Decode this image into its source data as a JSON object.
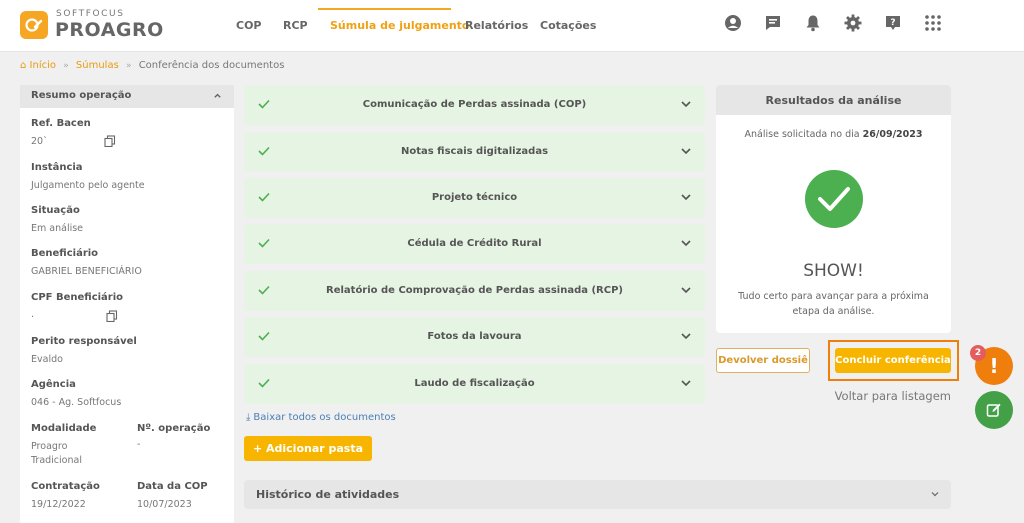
{
  "brand": {
    "small": "SOFTFOCUS",
    "big": "PROAGRO"
  },
  "nav": [
    {
      "label": "COP"
    },
    {
      "label": "RCP"
    },
    {
      "label": "Súmula de julgamento",
      "active": true
    },
    {
      "label": "Relatórios"
    },
    {
      "label": "Cotações"
    }
  ],
  "header_icons": [
    "user-icon",
    "chat-icon",
    "bell-icon",
    "gear-icon",
    "help-icon",
    "apps-grid-icon"
  ],
  "breadcrumb": {
    "home": "Início",
    "level2": "Súmulas",
    "current": "Conferência dos documentos",
    "home_icon": "home-icon"
  },
  "summary": {
    "title": "Resumo operação",
    "fields": {
      "ref_bacen": {
        "label": "Ref. Bacen",
        "value": "20`"
      },
      "instancia": {
        "label": "Instância",
        "value": "Julgamento pelo agente"
      },
      "situacao": {
        "label": "Situação",
        "value": "Em análise"
      },
      "beneficiario": {
        "label": "Beneficiário",
        "value": "GABRIEL BENEFICIÁRIO"
      },
      "cpf": {
        "label": "CPF Beneficiário",
        "value": "."
      },
      "perito": {
        "label": "Perito responsável",
        "value": "Evaldo"
      },
      "agencia": {
        "label": "Agência",
        "value": "046 - Ag. Softfocus"
      },
      "modalidade": {
        "label": "Modalidade",
        "value_line1": "Proagro",
        "value_line2": "Tradicional"
      },
      "n_operacao": {
        "label": "Nº. operação",
        "value": "-"
      },
      "contratacao": {
        "label": "Contratação",
        "value": "19/12/2022"
      },
      "data_cop": {
        "label": "Data da COP",
        "value": "10/07/2023"
      }
    }
  },
  "documents": [
    {
      "title": "Comunicação de Perdas assinada (COP)",
      "status": "ok"
    },
    {
      "title": "Notas fiscais digitalizadas",
      "status": "ok"
    },
    {
      "title": "Projeto técnico",
      "status": "ok"
    },
    {
      "title": "Cédula de Crédito Rural",
      "status": "ok"
    },
    {
      "title": "Relatório de Comprovação de Perdas assinada (RCP)",
      "status": "ok"
    },
    {
      "title": "Fotos da lavoura",
      "status": "ok"
    },
    {
      "title": "Laudo de fiscalização",
      "status": "ok"
    }
  ],
  "actions": {
    "download_all": "Baixar todos os documentos",
    "add_folder": "+ Adicionar pasta",
    "history": "Histórico de atividades"
  },
  "results": {
    "title": "Resultados da análise",
    "requested_prefix": "Análise solicitada no dia",
    "requested_date": "26/09/2023",
    "headline": "SHOW!",
    "message": "Tudo certo para avançar para a próxima etapa da análise."
  },
  "buttons": {
    "return": "Devolver dossiê",
    "conclude": "Concluir conferência",
    "back": "Voltar para listagem"
  },
  "fab": {
    "badge": "2",
    "alert_symbol": "!"
  },
  "colors": {
    "accent": "#f5a623",
    "success": "#4caf50",
    "success_bg": "#e6f4e3",
    "highlight": "#f07e0c",
    "link": "#4a7fb5"
  }
}
